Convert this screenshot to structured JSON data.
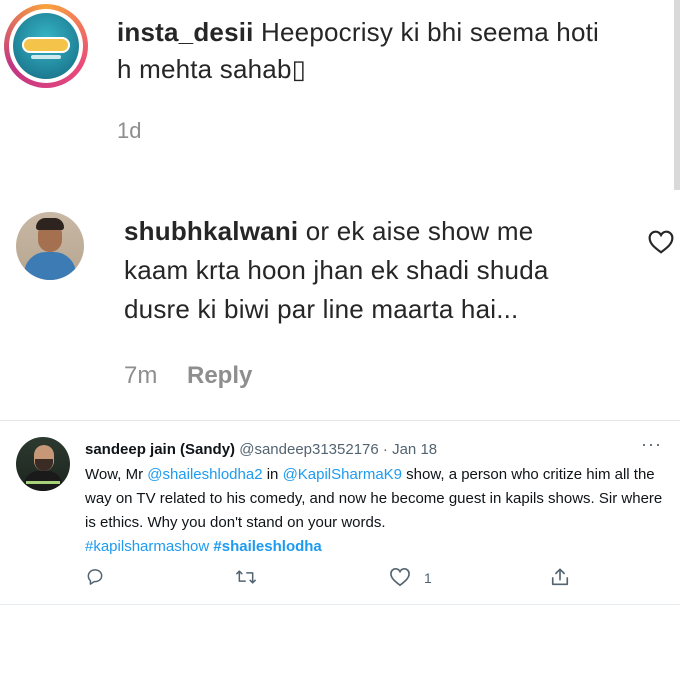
{
  "comments": [
    {
      "username": "insta_desii",
      "text_line1": "Heepocrisy ki bhi seema hoti",
      "text_line2": "h mehta sahab▯",
      "time": "1d"
    },
    {
      "username": "shubhkalwani",
      "text_line1": "or ek aise show me",
      "text_line2": "kaam krta hoon jhan ek shadi shuda",
      "text_line3": "dusre ki biwi par line maarta hai...",
      "time": "7m",
      "reply_label": "Reply"
    }
  ],
  "tweet": {
    "display_name": "sandeep jain (Sandy)",
    "handle": "@sandeep31352176",
    "separator": "·",
    "date": "Jan 18",
    "more": "···",
    "body": {
      "p1": "Wow, Mr ",
      "mention1": "@shaileshlodha2",
      "p2": " in ",
      "mention2": "@KapilSharmaK9",
      "p3": " show, a person who critize him all the way on TV related to his comedy, and now he become guest in kapils shows. Sir where is ethics. Why you don't stand on your words.",
      "hashtag1": "#kapilsharmashow",
      "hashtag2": "#shaileshlodha"
    },
    "like_count": "1"
  },
  "icons": {
    "comment_heart": "heart-outline-icon",
    "reply": "speech-bubble-icon",
    "retweet": "retweet-icon",
    "like": "heart-outline-icon",
    "share": "share-icon"
  },
  "colors": {
    "link": "#1d9bf0",
    "ig_text": "#262626",
    "ig_muted": "#8e8e8e",
    "tw_muted": "#536471"
  }
}
